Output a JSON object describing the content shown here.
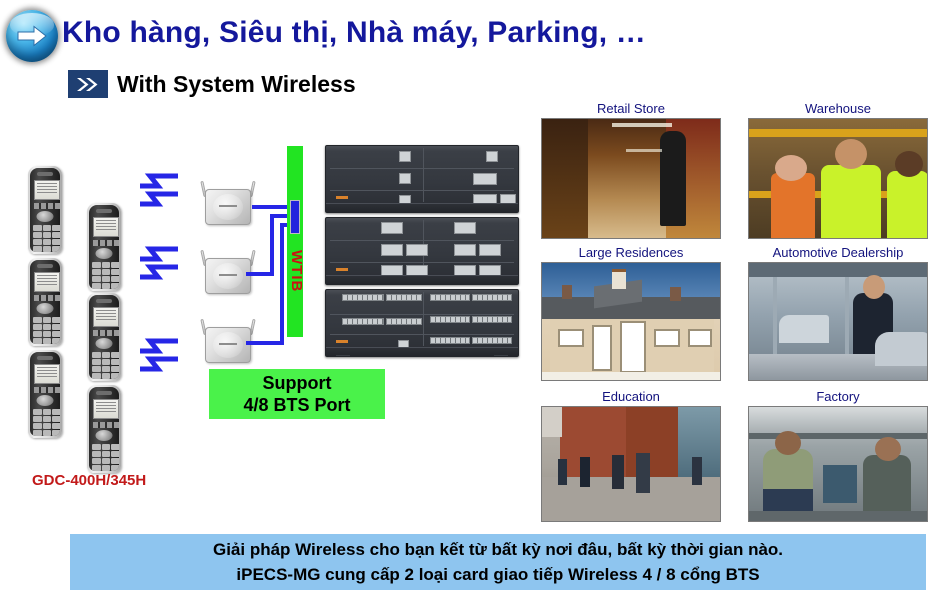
{
  "header": {
    "icon": "blue-arrow-circle-icon",
    "title": "Kho hàng, Siêu thị, Nhà máy, Parking, …",
    "title_color": "#14189c",
    "sub_bullet_icon": "double-chevron-right-icon",
    "subtitle": "With System Wireless"
  },
  "diagram": {
    "wtib_label": "WTIB",
    "wtib_color": "#22e422",
    "wtib_text_color": "#cc1111",
    "support_box": {
      "line1": "Support",
      "line2": "4/8 BTS Port",
      "color": "#4af24a"
    },
    "device_label": "GDC-400H/345H",
    "device_label_color": "#c21a1a",
    "handset_count": 6,
    "access_point_count": 3,
    "signal_count": 3,
    "link_color": "#2626e6"
  },
  "photos": [
    {
      "caption": "Retail Store",
      "name": "photo-retail-store"
    },
    {
      "caption": "Warehouse",
      "name": "photo-warehouse"
    },
    {
      "caption": "Large Residences",
      "name": "photo-large-residences"
    },
    {
      "caption": "Automotive Dealership",
      "name": "photo-automotive-dealership"
    },
    {
      "caption": "Education",
      "name": "photo-education"
    },
    {
      "caption": "Factory",
      "name": "photo-factory"
    }
  ],
  "banner": {
    "line1": "Giải pháp Wireless cho bạn kết từ bất kỳ nơi đâu, bất kỳ thời gian nào.",
    "line2": "iPECS-MG cung cấp 2 loại card giao tiếp Wireless 4 / 8 cổng BTS",
    "background": "#8ec5ef"
  }
}
